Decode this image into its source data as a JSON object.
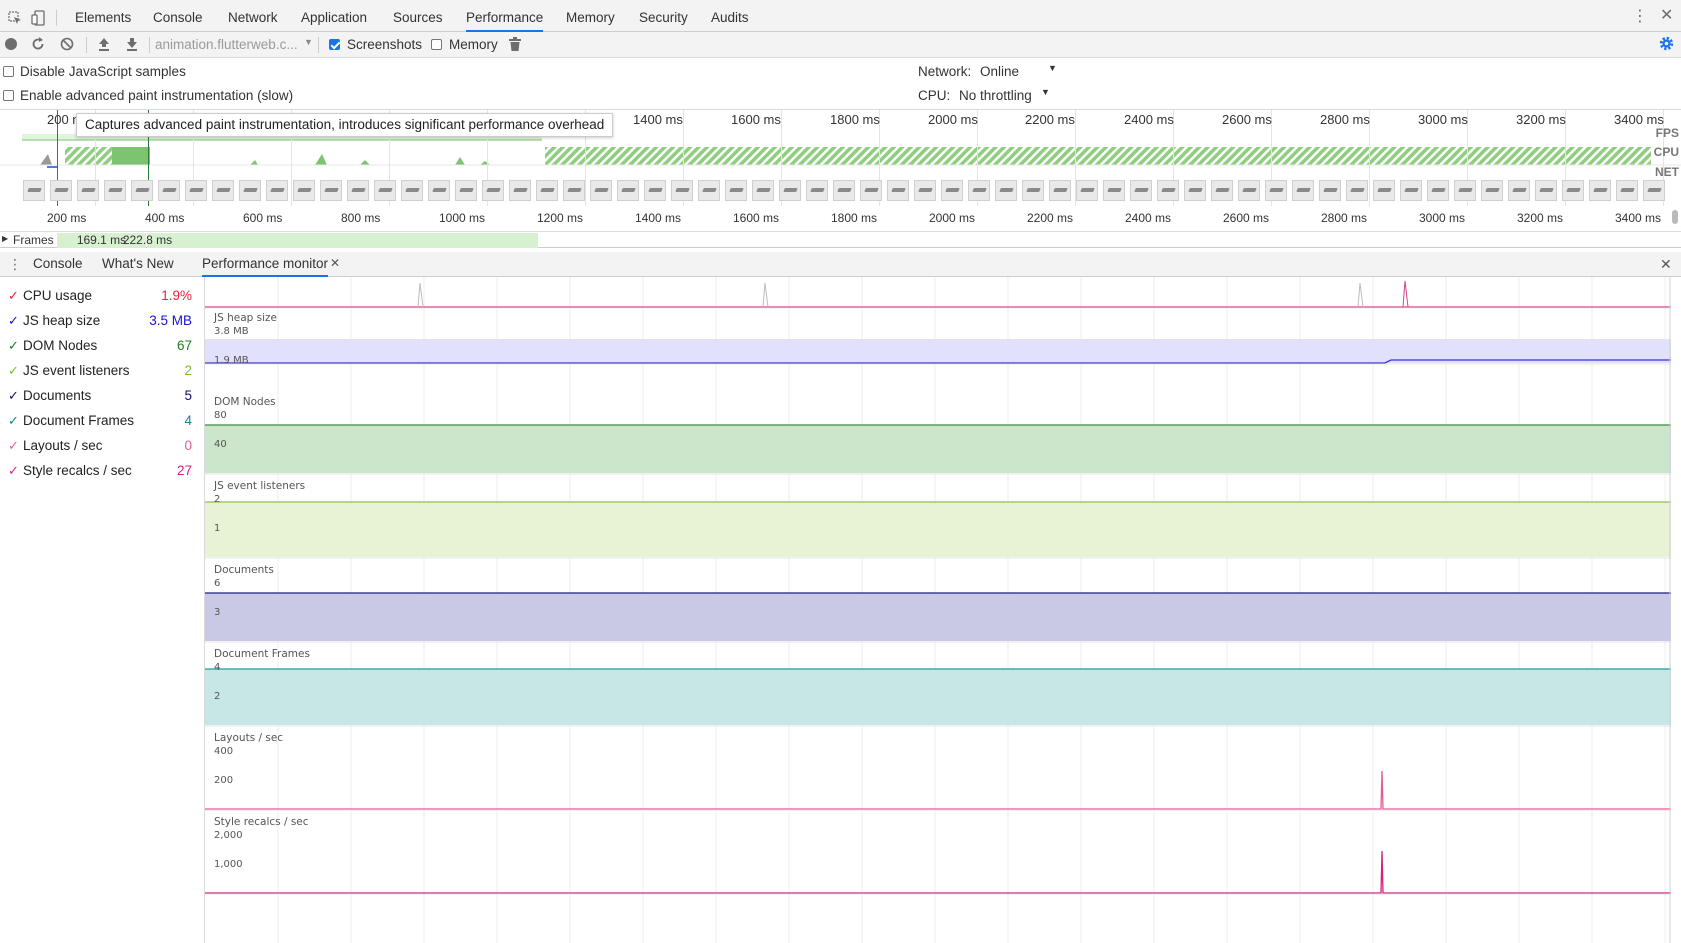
{
  "main_tabs": [
    "Elements",
    "Console",
    "Network",
    "Application",
    "Sources",
    "Performance",
    "Memory",
    "Security",
    "Audits"
  ],
  "selected_main_tab": "Performance",
  "toolbar": {
    "url": "animation.flutterweb.c...",
    "screenshots_label": "Screenshots",
    "screenshots_checked": true,
    "memory_label": "Memory",
    "memory_checked": false
  },
  "settings": {
    "disable_js_samples_label": "Disable JavaScript samples",
    "advanced_paint_label": "Enable advanced paint instrumentation (slow)",
    "network_label": "Network:",
    "network_value": "Online",
    "cpu_label": "CPU:",
    "cpu_value": "No throttling"
  },
  "overview": {
    "tooltip": "Captures advanced paint instrumentation, introduces significant performance overhead",
    "top_ticks": [
      "200 m",
      "1400 ms",
      "1600 ms",
      "1800 ms",
      "2000 ms",
      "2200 ms",
      "2400 ms",
      "2600 ms",
      "2800 ms",
      "3000 ms",
      "3200 ms",
      "3400 ms"
    ],
    "bottom_ticks": [
      "200 ms",
      "400 ms",
      "600 ms",
      "800 ms",
      "1000 ms",
      "1200 ms",
      "1400 ms",
      "1600 ms",
      "1800 ms",
      "2000 ms",
      "2200 ms",
      "2400 ms",
      "2600 ms",
      "2800 ms",
      "3000 ms",
      "3200 ms",
      "3400 ms"
    ],
    "track_labels": [
      "FPS",
      "CPU",
      "NET"
    ],
    "frames_label": "Frames",
    "frame_values": [
      "169.1 ms",
      "222.8 ms"
    ]
  },
  "drawer_tabs": [
    "Console",
    "What's New",
    "Performance monitor"
  ],
  "selected_drawer_tab": "Performance monitor",
  "metrics": [
    {
      "name": "CPU usage",
      "value": "1.9%",
      "color": "#e8203c"
    },
    {
      "name": "JS heap size",
      "value": "3.5 MB",
      "color": "#1a12c9"
    },
    {
      "name": "DOM Nodes",
      "value": "67",
      "color": "#1e7d1e"
    },
    {
      "name": "JS event listeners",
      "value": "2",
      "color": "#7bbf2a"
    },
    {
      "name": "Documents",
      "value": "5",
      "color": "#0d0d6e"
    },
    {
      "name": "Document Frames",
      "value": "4",
      "color": "#0e8a8a"
    },
    {
      "name": "Layouts / sec",
      "value": "0",
      "color": "#e75a9a"
    },
    {
      "name": "Style recalcs / sec",
      "value": "27",
      "color": "#d8217a"
    }
  ],
  "charts": [
    {
      "title": "",
      "ticks": [],
      "line": "#d6418c",
      "fill": "none"
    },
    {
      "title": "JS heap size",
      "ticks": [
        "3.8 MB",
        "1.9 MB"
      ],
      "line": "#3a34c9",
      "fill": "#c8c6fb",
      "fill_top": "#e2e1fc"
    },
    {
      "title": "DOM Nodes",
      "ticks": [
        "80",
        "40"
      ],
      "line": "#3d8a3d",
      "fill": "#cbe6cb"
    },
    {
      "title": "JS event listeners",
      "ticks": [
        "2",
        "1"
      ],
      "line": "#8dbf52",
      "fill": "#e8f3d6"
    },
    {
      "title": "Documents",
      "ticks": [
        "6",
        "3"
      ],
      "line": "#1d1d7a",
      "fill": "#c9c9e5"
    },
    {
      "title": "Document Frames",
      "ticks": [
        "4",
        "2"
      ],
      "line": "#239a9a",
      "fill": "#c7e7e7"
    },
    {
      "title": "Layouts / sec",
      "ticks": [
        "400",
        "200"
      ],
      "line": "#e75a9a",
      "fill": "none"
    },
    {
      "title": "Style recalcs / sec",
      "ticks": [
        "2,000",
        "1,000"
      ],
      "line": "#d8217a",
      "fill": "none"
    }
  ]
}
